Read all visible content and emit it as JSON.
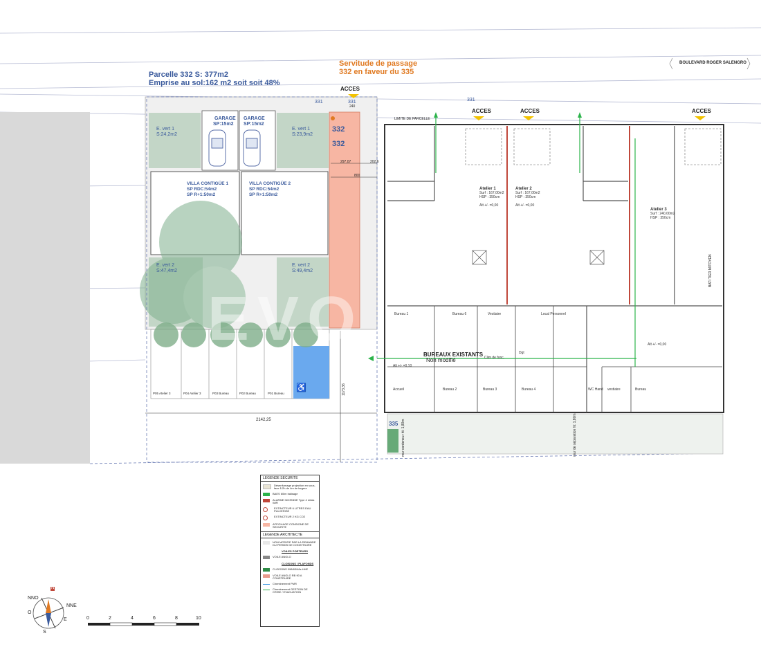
{
  "parcel": {
    "line1": "Parcelle 332 S:   377m2",
    "line2": "Emprise au sol:162 m2 soit  soit 48%"
  },
  "servitude": {
    "line1": "Servitude de passage",
    "line2": "332 en faveur du 335"
  },
  "street_sign": "BOULEVARD ROGER SALENGRO",
  "lot_numbers": {
    "n331a": "331",
    "n331b": "331",
    "n331c": "331",
    "n332a": "332",
    "n332b": "332",
    "n335": "335"
  },
  "acces": {
    "a1": "ACCES",
    "a2": "ACCES",
    "a3": "ACCES",
    "a4": "ACCES"
  },
  "limite": "LIMITE DE PARCELLE",
  "dims": {
    "d240": "240",
    "d297": "297,07",
    "d202": "202,6",
    "d800": "800",
    "d2142": "2142,25",
    "d1173": "1173,36"
  },
  "villas": {
    "garage1": {
      "title": "GARAGE",
      "area": "SP:15m2"
    },
    "garage2": {
      "title": "GARAGE",
      "area": "SP:15m2"
    },
    "villa1": {
      "title": "VILLA CONTIGÜE 1",
      "l1": "SP RDC:54m2",
      "l2": "SP R+1:50m2"
    },
    "villa2": {
      "title": "VILLA CONTIGÜE 2",
      "l1": "SP RDC:54m2",
      "l2": "SP R+1:50m2"
    },
    "ev1": {
      "title": "E. vert 1",
      "area": "S:24,2m2"
    },
    "ev2": {
      "title": "E. vert 1",
      "area": "S:23,9m2"
    },
    "ev3": {
      "title": "E. vert 2",
      "area": "S:47,4m2"
    },
    "ev4": {
      "title": "E. vert 2",
      "area": "S:49,4m2"
    }
  },
  "parking": [
    "P05 Atelier 3",
    "P04 Atelier 3",
    "P03 Bureau",
    "P02 Bureau",
    "P01 Bureau"
  ],
  "ateliers": {
    "a1": {
      "title": "Atelier 1",
      "l1": "Surf : 167,00m2",
      "l2": "HSP : 350cm",
      "alt": "Alt +/- =0,00"
    },
    "a2": {
      "title": "Atelier 2",
      "l1": "Surf : 167,00m2",
      "l2": "HSP : 350cm",
      "alt": "Alt +/- =0,00"
    },
    "a3": {
      "title": "Atelier 3",
      "l1": "Surf : 240,00m2",
      "l2": "HSP : 350cm"
    }
  },
  "bureaux": {
    "title": "BUREAUX EXISTANTS",
    "sub": "Non modifié",
    "rooms": [
      "Bureau 1",
      "Bureau 6",
      "Vestiaire",
      "Local Personnel",
      "Dgt",
      "Accueil",
      "Bureau 2",
      "Bureau 3",
      "Bureau 4",
      "WC Hand",
      "Bureau",
      "vestiaire",
      "Clim de fonc."
    ],
    "alt1": "Alt +/- =0,10",
    "alt2": "Alt +/- =0,00"
  },
  "wall_labels": {
    "mitoyen": "BATI TIER MITOYEN",
    "separation": "mur de séparation ht: 1,80m",
    "conteneur": "mur conteneur ht: 1,80m"
  },
  "legend": {
    "securite_title": "LEGENDE SECURITE",
    "s1": "Désenfumage projection en sous-face 1/2h de 4m de largeur",
    "s2": "BAES 60lm balisage",
    "s3": "ALARME INCENDIE Type 4 relais WiFi",
    "s4": "EXTINCTEUR 6 LITRES EAU PULVERISE",
    "s5": "EXTINCTEUR 2 KG CO2",
    "s6": "AFFICHAGE CONSIGNE DE SECURITE",
    "archi_title": "LEGENDE ARCHITECTE",
    "a1": "NON MODIFIE PAR LA DEMANDE DU PERMIS DE CONSTRUIRE",
    "voiles": "VOILES PORTEURS",
    "a2": "VOILE ANGLO",
    "cloisons": "CLOISONS / PLAFONDS",
    "a3": "CLOISONS 098/63/48s HHE",
    "a4": "VOILE ANGLO RB 90 A CONSTRUIRE",
    "a5": "Cheminement PMR",
    "a6": "Cheminement GESTION DE CRISE / EVACUATION"
  },
  "compass": {
    "n": "N",
    "nno": "NNO",
    "nne": "NNE",
    "o": "O",
    "e": "E",
    "s": "S"
  },
  "scale": [
    "0",
    "2",
    "4",
    "6",
    "8",
    "10"
  ],
  "colors": {
    "blue_text": "#3a5a9c",
    "orange": "#e07a22",
    "servitude": "#f7b6a3",
    "green_zone": "#c3d6c7",
    "red_wall": "#c0473a",
    "green_path": "#2bb34a",
    "blue_pmr": "#4aa0e6"
  }
}
